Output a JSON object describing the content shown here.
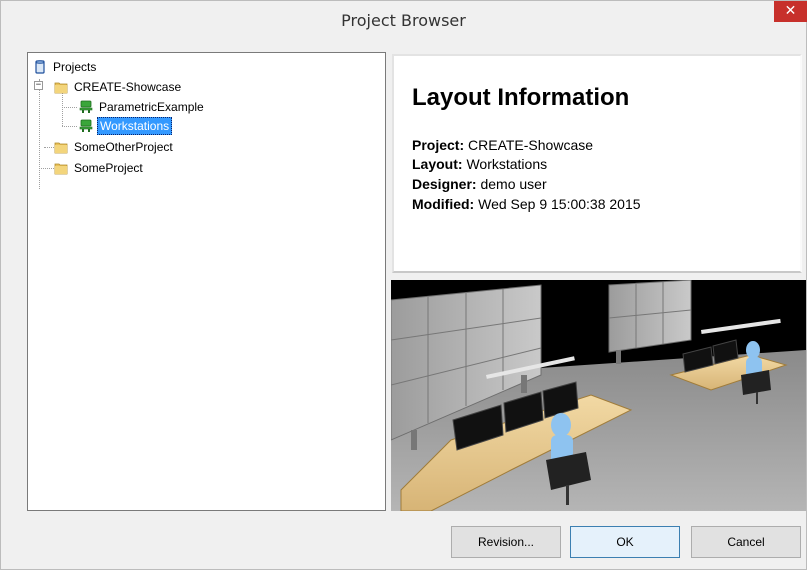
{
  "window": {
    "title": "Project Browser",
    "close_glyph": "✕"
  },
  "tree": {
    "root": {
      "label": "Projects",
      "icon": "database-icon"
    },
    "projects": [
      {
        "label": "CREATE-Showcase",
        "icon": "folder-icon",
        "expanded": true,
        "expander_glyph": "−",
        "children": [
          {
            "label": "ParametricExample",
            "icon": "workstation-icon",
            "selected": false
          },
          {
            "label": "Workstations",
            "icon": "workstation-icon",
            "selected": true
          }
        ]
      },
      {
        "label": "SomeOtherProject",
        "icon": "folder-icon"
      },
      {
        "label": "SomeProject",
        "icon": "folder-icon"
      }
    ]
  },
  "info": {
    "heading": "Layout Information",
    "project_label": "Project:",
    "project_value": " CREATE-Showcase",
    "layout_label": "Layout:",
    "layout_value": " Workstations",
    "designer_label": "Designer:",
    "designer_value": " demo user",
    "modified_label": "Modified:",
    "modified_value": " Wed Sep 9 15:00:38 2015"
  },
  "buttons": {
    "revision": "Revision...",
    "ok": "OK",
    "cancel": "Cancel"
  },
  "colors": {
    "selection": "#3399ff",
    "close": "#c7302b",
    "folder": "#e8c15a",
    "workstation": "#3aa63a"
  }
}
